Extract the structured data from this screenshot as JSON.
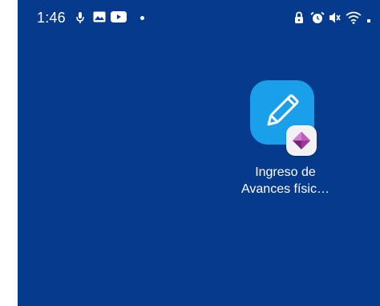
{
  "status_bar": {
    "time": "1:46",
    "left_icons": [
      "mic-icon",
      "image-icon",
      "youtube-icon",
      "notification-dot"
    ],
    "right_icons": [
      "lock-icon",
      "alarm-icon",
      "mute-icon",
      "wifi-icon"
    ]
  },
  "home_screen": {
    "background_color": "#063a8c",
    "apps": [
      {
        "label_line1": "Ingreso de",
        "label_line2": "Avances físic…",
        "icon": "pencil-icon",
        "badge_icon": "power-apps-icon",
        "tile_color": "#1aa0ea"
      }
    ]
  }
}
